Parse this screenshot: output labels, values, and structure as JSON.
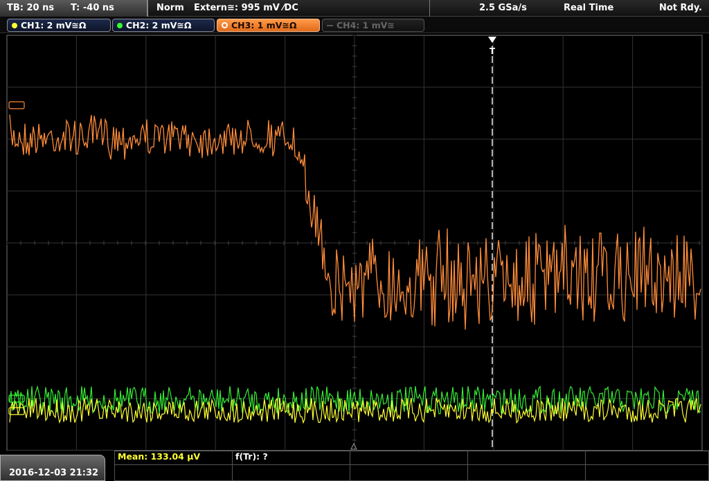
{
  "topbar": {
    "timebase": "TB: 20 ns",
    "trigger_time": "T: -40 ns",
    "trigger_mode": "Norm",
    "trigger_source": "Extern≅: 995 mV ⁄DC",
    "sample_rate": "2.5 GSa/s",
    "acq_mode": "Real Time",
    "status": "Not Rdy."
  },
  "channels": [
    {
      "label": "CH1: 2 mV≅Ω",
      "color": "#ffff33"
    },
    {
      "label": "CH2: 2 mV≅Ω",
      "color": "#33ff33"
    },
    {
      "label": "CH3: 1 mV≅Ω",
      "color": "#ff8c3a"
    },
    {
      "label": "CH4: 1 mV≅",
      "color": "#555555"
    }
  ],
  "trigger_marker": "T",
  "ch3_wave": {
    "color": "#ff8c3a"
  },
  "ch2_wave": {
    "color": "#33ee33"
  },
  "ch1_wave": {
    "color": "#ffff33"
  },
  "bottombar": {
    "datetime": "2016-12-03 21:32",
    "mean": "Mean: 133.04 µV",
    "f_tr": "f(Tr): ?"
  }
}
